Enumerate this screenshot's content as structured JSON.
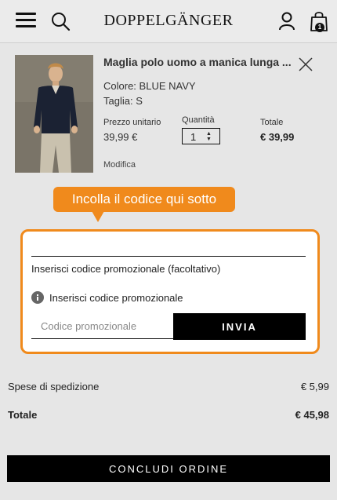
{
  "header": {
    "logo": "DOPPELGÄNGER",
    "cart_count": "1"
  },
  "product": {
    "title": "Maglia polo uomo a manica lunga ...",
    "color_label": "Colore:",
    "color_value": "BLUE NAVY",
    "size_label": "Taglia:",
    "size_value": "S",
    "unit_price_label": "Prezzo unitario",
    "unit_price": "39,99 €",
    "quantity_label": "Quantità",
    "quantity": "1",
    "total_label": "Totale",
    "total": "€ 39,99",
    "modify_label": "Modifica"
  },
  "callout": {
    "text": "Incolla il codice qui sotto",
    "color": "#f08a1c"
  },
  "promo": {
    "heading": "Inserisci codice promozionale (facoltativo)",
    "subheading": "Inserisci codice promozionale",
    "input_placeholder": "Codice promozionale",
    "input_value": "",
    "submit_label": "INVIA"
  },
  "summary": {
    "shipping_label": "Spese di spedizione",
    "shipping_value": "€ 5,99",
    "total_label": "Totale",
    "total_value": "€ 45,98"
  },
  "checkout": {
    "label": "CONCLUDI ORDINE"
  },
  "icons": [
    "menu-icon",
    "search-icon",
    "account-icon",
    "cart-icon",
    "close-icon",
    "info-icon",
    "chevron-updown-icon"
  ]
}
